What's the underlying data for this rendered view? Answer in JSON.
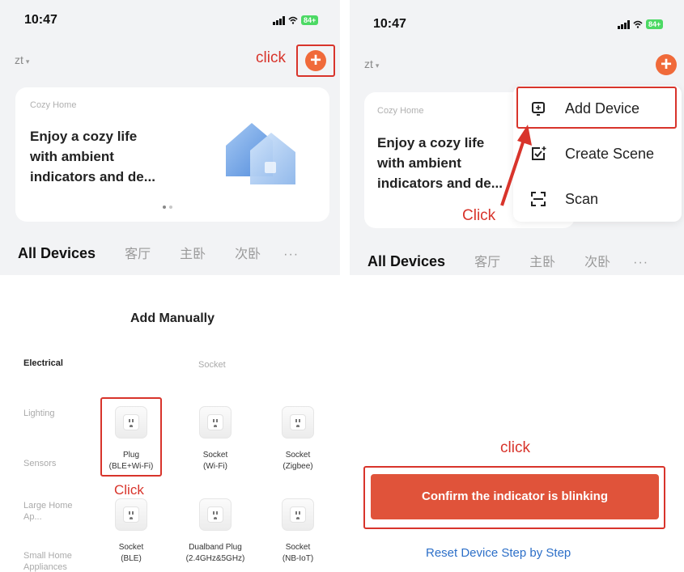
{
  "panel1": {
    "time": "10:47",
    "battery": "84+",
    "home_name": "zt",
    "caret": "▾",
    "annotation": "click",
    "plus": "+",
    "card": {
      "small": "Cozy Home",
      "line1": "Enjoy a cozy life",
      "line2": "with ambient",
      "line3": "indicators and de..."
    },
    "tabs": [
      "All Devices",
      "客厅",
      "主卧",
      "次卧"
    ],
    "more": "···"
  },
  "panel2": {
    "time": "10:47",
    "battery": "84+",
    "home_name": "zt",
    "caret": "▾",
    "plus": "+",
    "card": {
      "small": "Cozy Home",
      "line1": "Enjoy a cozy life",
      "line2": "with ambient",
      "line3": "indicators and de..."
    },
    "menu": [
      {
        "label": "Add Device",
        "icon": "add-device-icon"
      },
      {
        "label": "Create Scene",
        "icon": "create-scene-icon"
      },
      {
        "label": "Scan",
        "icon": "scan-icon"
      }
    ],
    "annotation": "Click",
    "tabs": [
      "All Devices",
      "客厅",
      "主卧",
      "次卧"
    ],
    "more": "···"
  },
  "panel3": {
    "title": "Add Manually",
    "categories": [
      "Electrical",
      "Lighting",
      "Sensors",
      "Large Home Ap...",
      "Small Home Appliances"
    ],
    "subhead": "Socket",
    "devices": [
      {
        "line1": "Plug",
        "line2": "(BLE+Wi-Fi)"
      },
      {
        "line1": "Socket",
        "line2": "(Wi-Fi)"
      },
      {
        "line1": "Socket",
        "line2": "(Zigbee)"
      },
      {
        "line1": "Socket",
        "line2": "(BLE)"
      },
      {
        "line1": "Dualband Plug",
        "line2": "(2.4GHz&5GHz)"
      },
      {
        "line1": "Socket",
        "line2": "(NB-IoT)"
      }
    ],
    "annotation": "Click"
  },
  "panel4": {
    "annotation": "click",
    "confirm": "Confirm the indicator is blinking",
    "reset": "Reset Device Step by Step"
  },
  "colors": {
    "accent": "#f06a3a",
    "annotation_red": "#d8342b",
    "confirm_button": "#e0533a",
    "link_blue": "#2c6fc8",
    "background_gray": "#f2f3f5"
  }
}
